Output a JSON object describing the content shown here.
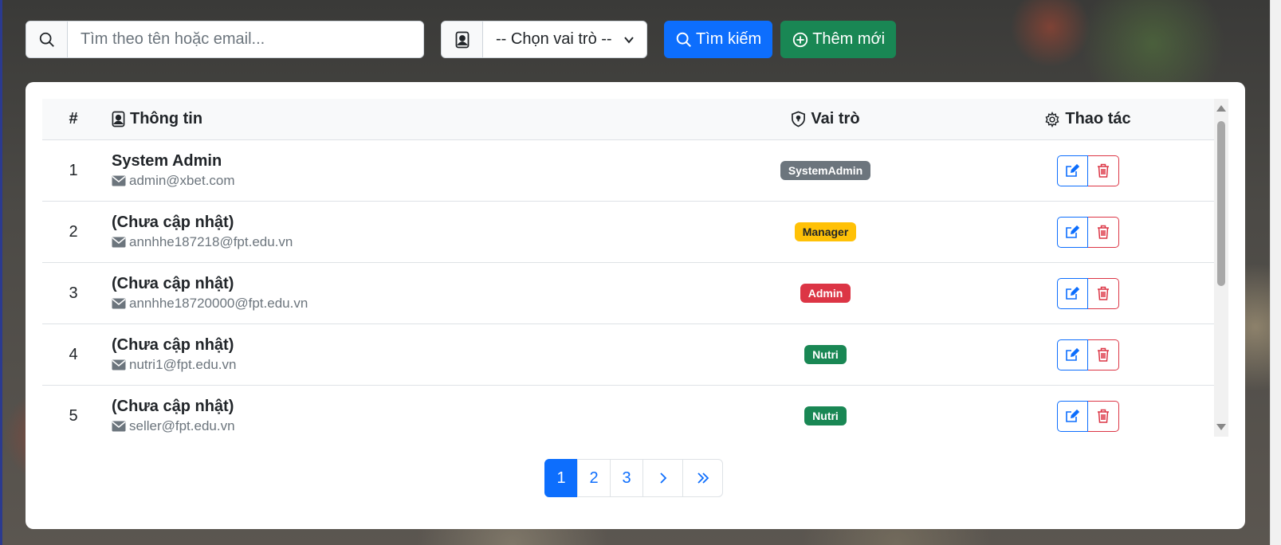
{
  "search": {
    "placeholder": "Tìm theo tên hoặc email..."
  },
  "role_filter": {
    "selected": "-- Chọn vai trò --"
  },
  "buttons": {
    "search": "Tìm kiếm",
    "add_new": "Thêm mới"
  },
  "table": {
    "headers": {
      "num": "#",
      "info": "Thông tin",
      "role": "Vai trò",
      "action": "Thao tác"
    },
    "rows": [
      {
        "num": "1",
        "name": "System Admin",
        "email": "admin@xbet.com",
        "role": "SystemAdmin",
        "role_color": "#6c757d",
        "role_text_color": "#ffffff"
      },
      {
        "num": "2",
        "name": "(Chưa cập nhật)",
        "email": "annhhe187218@fpt.edu.vn",
        "role": "Manager",
        "role_color": "#ffc107",
        "role_text_color": "#212529"
      },
      {
        "num": "3",
        "name": "(Chưa cập nhật)",
        "email": "annhhe18720000@fpt.edu.vn",
        "role": "Admin",
        "role_color": "#dc3545",
        "role_text_color": "#ffffff"
      },
      {
        "num": "4",
        "name": "(Chưa cập nhật)",
        "email": "nutri1@fpt.edu.vn",
        "role": "Nutri",
        "role_color": "#198754",
        "role_text_color": "#ffffff"
      },
      {
        "num": "5",
        "name": "(Chưa cập nhật)",
        "email": "seller@fpt.edu.vn",
        "role": "Nutri",
        "role_color": "#198754",
        "role_text_color": "#ffffff"
      }
    ]
  },
  "pagination": {
    "pages": [
      "1",
      "2",
      "3"
    ],
    "active": "1",
    "next_icon": "chevron-right-icon",
    "last_icon": "chevrons-right-icon"
  },
  "colors": {
    "primary": "#0d6efd",
    "success": "#198754",
    "danger": "#dc3545"
  }
}
